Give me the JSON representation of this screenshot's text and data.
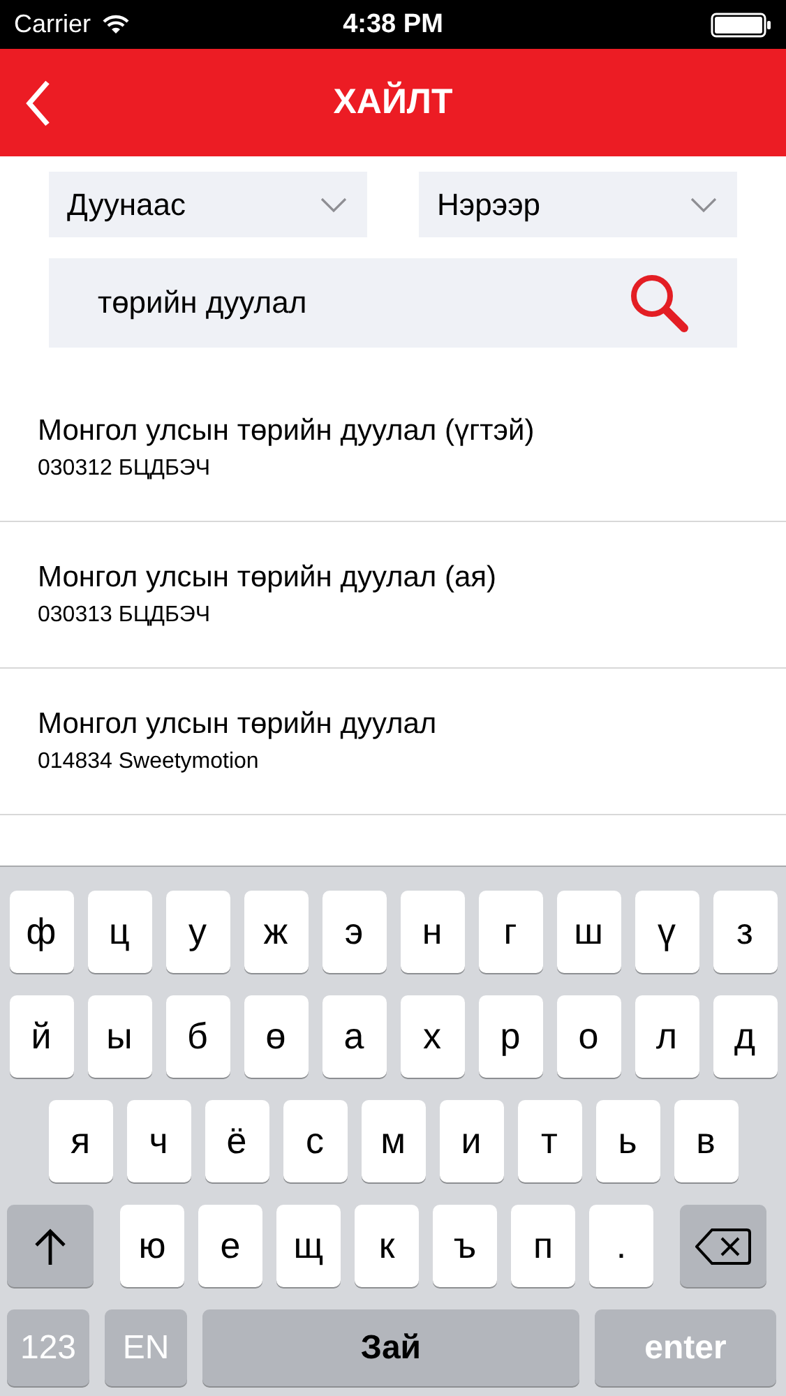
{
  "status_bar": {
    "carrier": "Carrier",
    "time": "4:38 PM"
  },
  "nav_bar": {
    "title": "ХАЙЛТ"
  },
  "filters": [
    {
      "value": "Дуунаас"
    },
    {
      "value": "Нэрээр"
    }
  ],
  "search": {
    "value": "төрийн дуулал"
  },
  "results": [
    {
      "title": "Монгол улсын төрийн дуулал (үгтэй)",
      "subtitle": "030312 БЦДБЭЧ"
    },
    {
      "title": "Монгол улсын төрийн дуулал (ая)",
      "subtitle": "030313 БЦДБЭЧ"
    },
    {
      "title": "Монгол улсын төрийн дуулал",
      "subtitle": "014834 Sweetymotion"
    }
  ],
  "keyboard": {
    "letter_rows": [
      [
        {
          "kind": "letter",
          "label": "ф"
        },
        {
          "kind": "letter",
          "label": "ц"
        },
        {
          "kind": "letter",
          "label": "у"
        },
        {
          "kind": "letter",
          "label": "ж"
        },
        {
          "kind": "letter",
          "label": "э"
        },
        {
          "kind": "letter",
          "label": "н"
        },
        {
          "kind": "letter",
          "label": "г"
        },
        {
          "kind": "letter",
          "label": "ш"
        },
        {
          "kind": "letter",
          "label": "ү"
        },
        {
          "kind": "letter",
          "label": "з"
        }
      ],
      [
        {
          "kind": "letter",
          "label": "й"
        },
        {
          "kind": "letter",
          "label": "ы"
        },
        {
          "kind": "letter",
          "label": "б"
        },
        {
          "kind": "letter",
          "label": "ө"
        },
        {
          "kind": "letter",
          "label": "а"
        },
        {
          "kind": "letter",
          "label": "х"
        },
        {
          "kind": "letter",
          "label": "р"
        },
        {
          "kind": "letter",
          "label": "о"
        },
        {
          "kind": "letter",
          "label": "л"
        },
        {
          "kind": "letter",
          "label": "д"
        }
      ],
      [
        {
          "kind": "letter",
          "label": "я"
        },
        {
          "kind": "letter",
          "label": "ч"
        },
        {
          "kind": "letter",
          "label": "ё"
        },
        {
          "kind": "letter",
          "label": "с"
        },
        {
          "kind": "letter",
          "label": "м"
        },
        {
          "kind": "letter",
          "label": "и"
        },
        {
          "kind": "letter",
          "label": "т"
        },
        {
          "kind": "letter",
          "label": "ь"
        },
        {
          "kind": "letter",
          "label": "в"
        }
      ],
      [
        {
          "kind": "shift"
        },
        {
          "kind": "letter",
          "label": "ю"
        },
        {
          "kind": "letter",
          "label": "е"
        },
        {
          "kind": "letter",
          "label": "щ"
        },
        {
          "kind": "letter",
          "label": "к"
        },
        {
          "kind": "letter",
          "label": "ъ"
        },
        {
          "kind": "letter",
          "label": "п"
        },
        {
          "kind": "letter",
          "label": "."
        },
        {
          "kind": "delete"
        }
      ]
    ],
    "bottom_keys": [
      {
        "kind": "numbers",
        "label": "123"
      },
      {
        "kind": "language",
        "label": "EN"
      },
      {
        "kind": "space",
        "label": "Зай"
      },
      {
        "kind": "enter",
        "label": "enter"
      }
    ]
  }
}
